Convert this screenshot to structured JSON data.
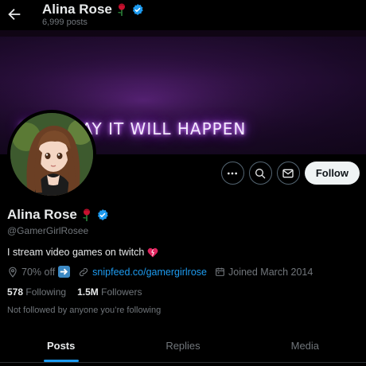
{
  "header": {
    "name": "Alina Rose",
    "posts_count": "6,999 posts"
  },
  "banner": {
    "text": "SOMEDAY IT WILL HAPPEN"
  },
  "actions": {
    "follow_label": "Follow"
  },
  "profile": {
    "name": "Alina Rose",
    "handle": "@GamerGirlRosee",
    "bio": "I stream video games on twitch",
    "location": "70% off",
    "link": "snipfeed.co/gamergirlrose",
    "joined": "Joined March 2014",
    "following_count": "578",
    "following_label": "Following",
    "followers_count": "1.5M",
    "followers_label": "Followers",
    "not_followed": "Not followed by anyone you’re following"
  },
  "tabs": [
    {
      "label": "Posts",
      "active": true
    },
    {
      "label": "Replies",
      "active": false
    },
    {
      "label": "Media",
      "active": false
    }
  ],
  "colors": {
    "accent": "#1d9bf0",
    "background": "#000000",
    "text_secondary": "#71767b"
  }
}
